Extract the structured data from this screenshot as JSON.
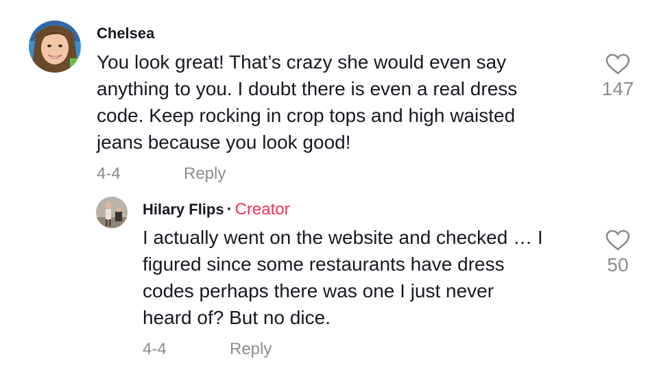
{
  "comment": {
    "username": "Chelsea",
    "text_lines": [
      "You look great! That’s crazy she would even say",
      "anything to you. I doubt there is even a real dress",
      "code. Keep rocking in crop tops and high waisted",
      "jeans because you look good!"
    ],
    "date": "4-4",
    "reply_label": "Reply",
    "like_count": "147"
  },
  "reply": {
    "username": "Hilary Flips",
    "separator": "·",
    "badge": "Creator",
    "text_lines": [
      "I actually went on the website and checked … I",
      "figured since some restaurants have dress",
      "codes perhaps there was one I just never",
      "heard of? But no dice."
    ],
    "date": "4-4",
    "reply_label": "Reply",
    "like_count": "50"
  },
  "icons": {
    "like": "heart-outline-icon"
  },
  "colors": {
    "creator_badge": "#fe2c55",
    "muted": "#8a8b91",
    "text": "#161823"
  }
}
